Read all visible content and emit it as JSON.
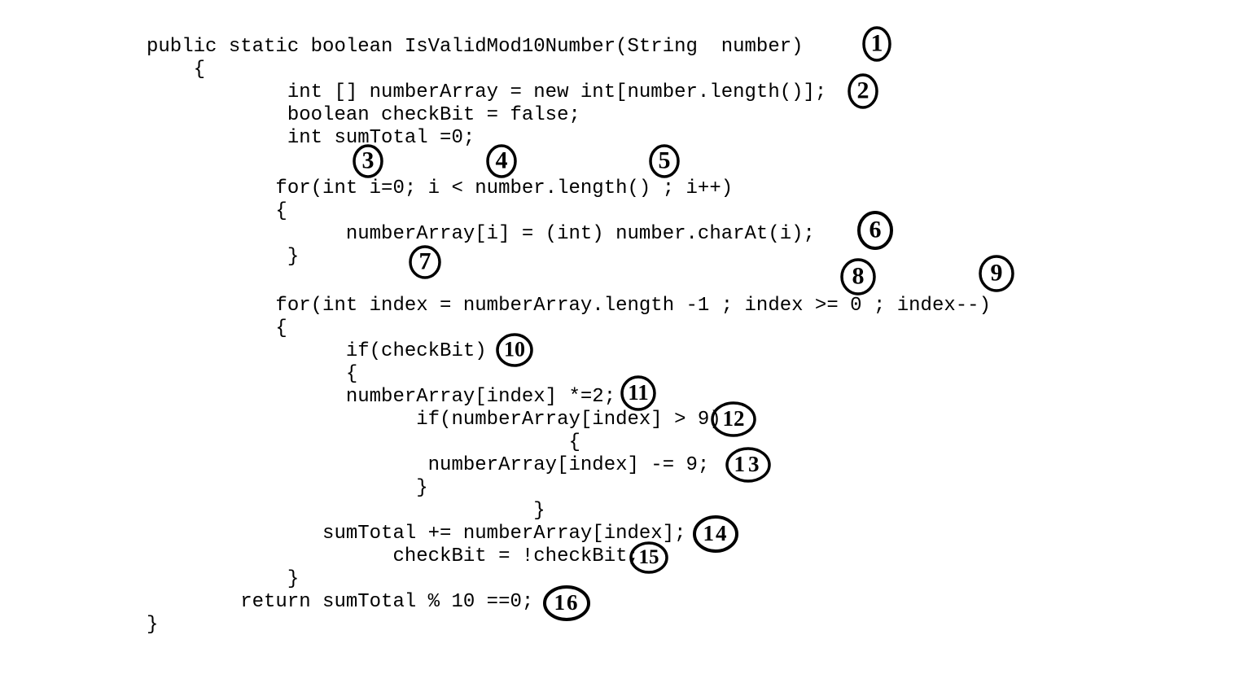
{
  "code": {
    "l1": "public static boolean IsValidMod10Number(String  number)",
    "l2": "    {",
    "l3": "            int [] numberArray = new int[number.length()];",
    "l4": "            boolean checkBit = false;",
    "l5": "            int sumTotal =0;",
    "l6": "",
    "l7": "           for(int i=0; i < number.length() ; i++)",
    "l8": "           {",
    "l9": "                 numberArray[i] = (int) number.charAt(i);",
    "l10": "            }",
    "l11": "",
    "l12": "           for(int index = numberArray.length -1 ; index >= 0 ; index--)",
    "l13": "           {",
    "l14": "                 if(checkBit)",
    "l15": "                 {",
    "l16": "                 numberArray[index] *=2;",
    "l17": "                       if(numberArray[index] > 9)",
    "l18": "                                    {",
    "l19": "                        numberArray[index] -= 9;",
    "l20": "                       }",
    "l21": "                                 }",
    "l22": "               sumTotal += numberArray[index];",
    "l23": "                     checkBit = !checkBit;",
    "l24": "            }",
    "l25": "        return sumTotal % 10 ==0;",
    "l26": "}"
  },
  "annotations": {
    "a1": "1",
    "a2": "2",
    "a3": "3",
    "a4": "4",
    "a5": "5",
    "a6": "6",
    "a7": "7",
    "a8": "8",
    "a9": "9",
    "a10": "10",
    "a11": "11",
    "a12": "12",
    "a13": "13",
    "a14": "14",
    "a15": "15",
    "a16": "16"
  }
}
